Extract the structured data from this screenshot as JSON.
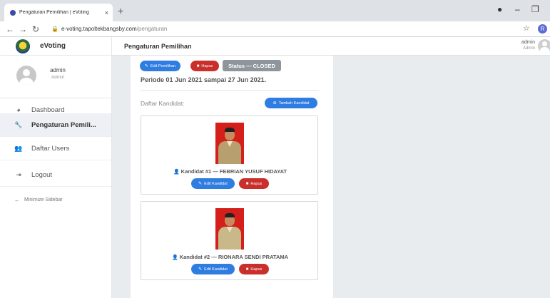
{
  "browser": {
    "tab_title": "Pengaturan Pemilihan | eVoting",
    "tab_close": "×",
    "new_tab": "+",
    "url_host": "e-voting.tapoltekbangsby.com",
    "url_path": "/pengaturan",
    "profile_initial": "R"
  },
  "sidebar": {
    "brand": "eVoting",
    "user_name": "admin",
    "user_role": "Admin",
    "items": [
      {
        "label": "Dashboard",
        "icon": "tachometer-icon"
      },
      {
        "label": "Pengaturan Pemili...",
        "icon": "wrench-icon",
        "active": true
      },
      {
        "label": "Daftar Users",
        "icon": "users-icon"
      },
      {
        "label": "Logout",
        "icon": "sign-out-icon"
      }
    ],
    "minimize": "Minimize Sidebar"
  },
  "topnav": {
    "title": "Pengaturan Pemilihan",
    "user_name": "admin",
    "user_role": "Admin"
  },
  "main": {
    "edit_pemilihan": "Edit Pemilihan",
    "hapus": "Hapus",
    "status": "Status — CLOSED",
    "periode": "Periode 01 Jun 2021 sampai 27 Jun 2021.",
    "daftar_kandidat": "Daftar Kandidat:",
    "tambah_kandidat": "Tambah Kandidat",
    "candidates": [
      {
        "label": "Kandidat #1 — FEBRIAN YUSUF HIDAYAT",
        "edit": "Edit Kandidat",
        "hapus": "Hapus"
      },
      {
        "label": "Kandidat #2 — RIONARA SENDI PRATAMA",
        "edit": "Edit Kandidat",
        "hapus": "Hapus"
      }
    ]
  },
  "colors": {
    "primary": "#2f7de1",
    "danger": "#c9302c",
    "status_gray": "#8e959c",
    "photo_bg": "#d41f1a"
  }
}
